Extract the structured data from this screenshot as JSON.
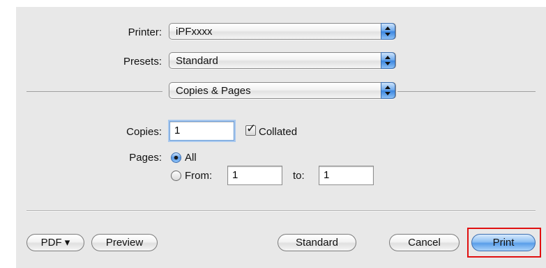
{
  "dialog": {
    "printer": {
      "label": "Printer:",
      "value": "iPFxxxx"
    },
    "presets": {
      "label": "Presets:",
      "value": "Standard"
    },
    "section_popup": {
      "value": "Copies & Pages"
    },
    "copies": {
      "label": "Copies:",
      "value": "1"
    },
    "collated": {
      "label": "Collated",
      "checked": true
    },
    "pages": {
      "label": "Pages:",
      "all_label": "All",
      "all_selected": true,
      "from_label": "From:",
      "from_value": "1",
      "to_label": "to:",
      "to_value": "1"
    },
    "buttons": {
      "pdf": "PDF ▾",
      "preview": "Preview",
      "standard": "Standard",
      "cancel": "Cancel",
      "print": "Print"
    },
    "highlight_color": "#e01010"
  }
}
